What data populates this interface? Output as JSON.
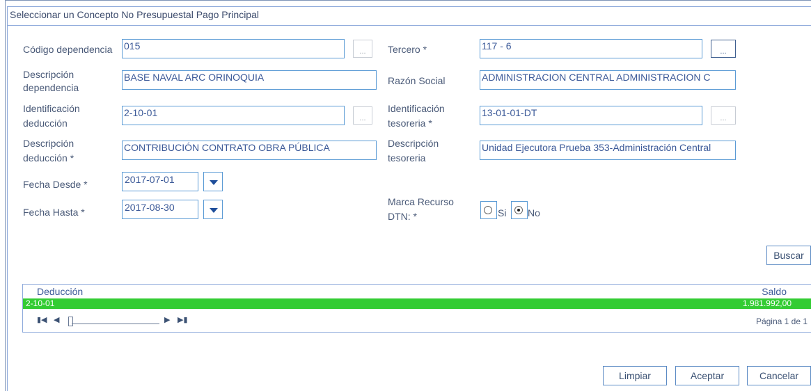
{
  "dialog": {
    "title": "Seleccionar un Concepto No Presupuestal Pago Principal"
  },
  "form": {
    "codigo_dependencia": {
      "label": "Código dependencia",
      "value": "015"
    },
    "descripcion_dependencia": {
      "label_1": "Descripción",
      "label_2": "dependencia",
      "value": "BASE NAVAL ARC ORINOQUIA"
    },
    "identificacion_deduccion": {
      "label_1": "Identificación",
      "label_2": "deducción",
      "value": "2-10-01"
    },
    "descripcion_deduccion": {
      "label_1": "Descripción",
      "label_2": "deducción *",
      "value": "CONTRIBUCIÓN CONTRATO OBRA PÚBLICA"
    },
    "fecha_desde": {
      "label": "Fecha Desde *",
      "value": "2017-07-01"
    },
    "fecha_hasta": {
      "label": "Fecha Hasta *",
      "value": "2017-08-30"
    },
    "tercero": {
      "label": "Tercero *",
      "value": "117 - 6"
    },
    "razon_social": {
      "label": "Razón Social",
      "value": "ADMINISTRACION CENTRAL ADMINISTRACION C"
    },
    "identificacion_tesoreria": {
      "label_1": "Identificación",
      "label_2": "tesoreria *",
      "value": "13-01-01-DT"
    },
    "descripcion_tesoreria": {
      "label_1": "Descripción",
      "label_2": "tesoreria",
      "value": "Unidad Ejecutora Prueba 353-Administración Central"
    },
    "marca_recurso": {
      "label_1": "Marca Recurso",
      "label_2": "DTN: *",
      "options": [
        "Si",
        "No"
      ],
      "selected": "No"
    },
    "dots_label": "..."
  },
  "buttons": {
    "buscar": "Buscar",
    "limpiar": "Limpiar",
    "aceptar": "Aceptar",
    "cancelar": "Cancelar"
  },
  "grid": {
    "columns": [
      "Deducción",
      "Saldo"
    ],
    "rows": [
      {
        "deduccion": "2-10-01",
        "saldo": "1.981.992,00"
      }
    ],
    "pager_text": "Página 1 de 1"
  },
  "colors": {
    "selected_row": "#33cc33",
    "field_border": "#5b9bd5"
  }
}
